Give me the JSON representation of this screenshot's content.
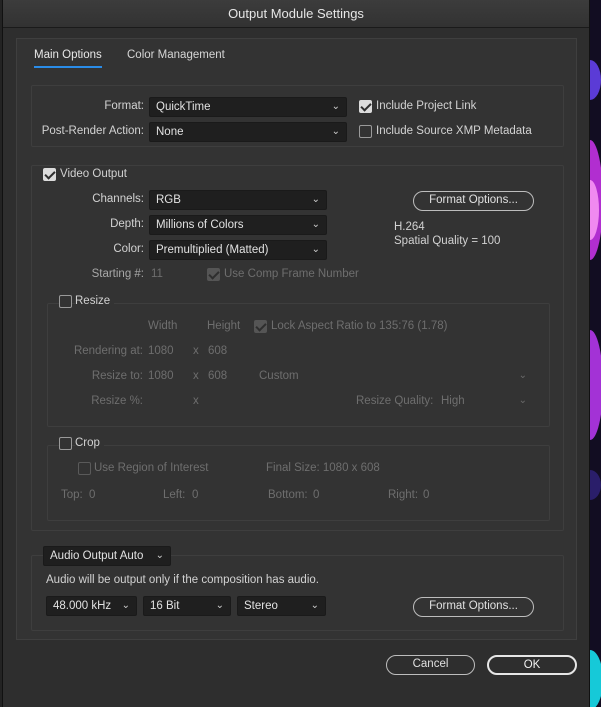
{
  "window": {
    "title": "Output Module Settings"
  },
  "tabs": [
    {
      "label": "Main Options",
      "active": true
    },
    {
      "label": "Color Management",
      "active": false
    }
  ],
  "format": {
    "format_label": "Format:",
    "format_value": "QuickTime",
    "post_render_label": "Post-Render Action:",
    "post_render_value": "None",
    "include_project_link": {
      "label": "Include Project Link",
      "checked": true
    },
    "include_xmp": {
      "label": "Include Source XMP Metadata",
      "checked": false
    }
  },
  "video_output": {
    "label": "Video Output",
    "checked": true,
    "channels_label": "Channels:",
    "channels_value": "RGB",
    "depth_label": "Depth:",
    "depth_value": "Millions of Colors",
    "color_label": "Color:",
    "color_value": "Premultiplied (Matted)",
    "starting_label": "Starting #:",
    "starting_value": "11",
    "use_comp_frame": {
      "label": "Use Comp Frame Number",
      "checked": true
    },
    "format_options_label": "Format Options...",
    "codec_info_line1": "H.264",
    "codec_info_line2": "Spatial Quality = 100"
  },
  "resize": {
    "label": "Resize",
    "checked": false,
    "width_header": "Width",
    "height_header": "Height",
    "lock_aspect": {
      "label": "Lock Aspect Ratio to 135:76 (1.78)",
      "checked": true
    },
    "rendering_at_label": "Rendering at:",
    "rendering_w": "1080",
    "rendering_x": "x",
    "rendering_h": "608",
    "resize_to_label": "Resize to:",
    "resize_to_w": "1080",
    "resize_to_x": "x",
    "resize_to_h": "608",
    "preset_value": "Custom",
    "resize_pct_label": "Resize %:",
    "resize_pct_x": "x",
    "quality_label": "Resize Quality:",
    "quality_value": "High"
  },
  "crop": {
    "label": "Crop",
    "checked": false,
    "use_roi": {
      "label": "Use Region of Interest",
      "checked": false
    },
    "final_size": "Final Size: 1080 x 608",
    "top_label": "Top:",
    "top_value": "0",
    "left_label": "Left:",
    "left_value": "0",
    "bottom_label": "Bottom:",
    "bottom_value": "0",
    "right_label": "Right:",
    "right_value": "0"
  },
  "audio": {
    "mode_value": "Audio Output Auto",
    "note": "Audio will be output only if the composition has audio.",
    "rate_value": "48.000 kHz",
    "bits_value": "16 Bit",
    "channels_value": "Stereo",
    "format_options_label": "Format Options..."
  },
  "footer": {
    "cancel_label": "Cancel",
    "ok_label": "OK"
  },
  "colors": {
    "accent": "#2a8ce8",
    "background": "#2e2e2e",
    "panel": "#333333"
  }
}
